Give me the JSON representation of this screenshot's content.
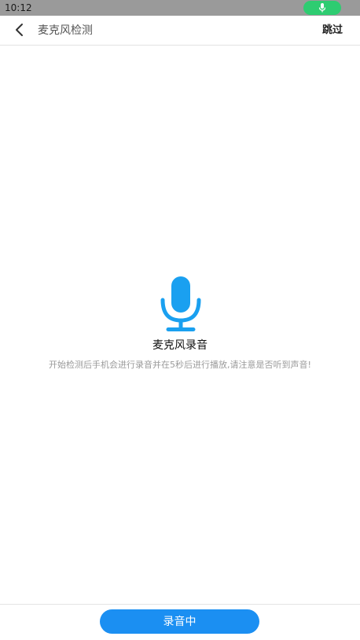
{
  "status_bar": {
    "time": "10:12",
    "mic_indicator_icon": "microphone-icon",
    "indicator_color": "#2ecc71"
  },
  "nav": {
    "back_icon": "chevron-left-icon",
    "title": "麦克风检测",
    "skip_label": "跳过"
  },
  "content": {
    "mic_icon": "microphone-icon",
    "mic_color": "#1aa0f0",
    "title": "麦克风录音",
    "hint": "开始检测后手机会进行录音并在5秒后进行播放,请注意是否听到声音!"
  },
  "footer": {
    "record_label": "录音中",
    "button_color": "#1b8ff2"
  }
}
